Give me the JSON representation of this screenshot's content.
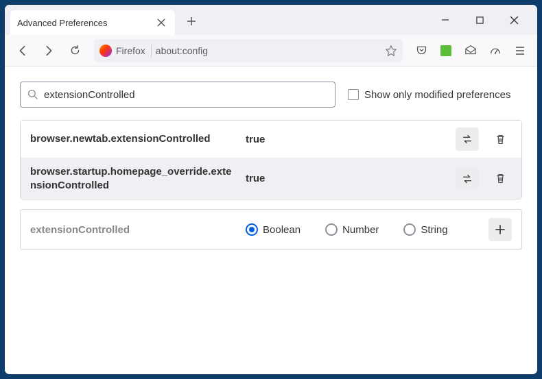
{
  "tab": {
    "title": "Advanced Preferences"
  },
  "url": {
    "identity": "Firefox",
    "address": "about:config"
  },
  "page": {
    "search": {
      "value": "extensionControlled"
    },
    "filter_label": "Show only modified preferences",
    "prefs": [
      {
        "name": "browser.newtab.extensionControlled",
        "value": "true"
      },
      {
        "name": "browser.startup.homepage_override.extensionControlled",
        "value": "true"
      }
    ],
    "add": {
      "name": "extensionControlled",
      "types": {
        "boolean": "Boolean",
        "number": "Number",
        "string": "String"
      }
    }
  }
}
